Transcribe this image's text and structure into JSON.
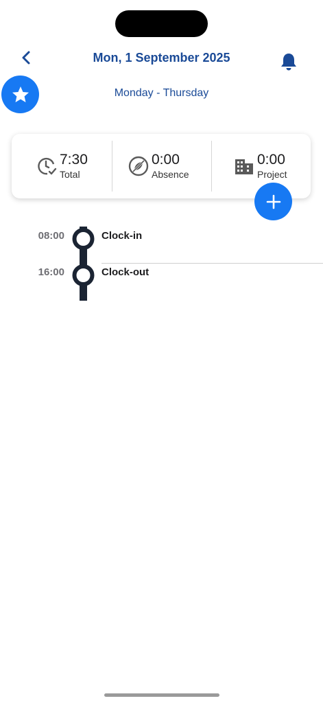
{
  "header": {
    "title": "Mon, 1 September 2025",
    "subtitle": "Monday - Thursday"
  },
  "summary": [
    {
      "icon": "clock-check-icon",
      "value": "7:30",
      "label": "Total"
    },
    {
      "icon": "absence-icon",
      "value": "0:00",
      "label": "Absence"
    },
    {
      "icon": "building-icon",
      "value": "0:00",
      "label": "Project"
    }
  ],
  "timeline": [
    {
      "time": "08:00",
      "label": "Clock-in"
    },
    {
      "time": "16:00",
      "label": "Clock-out"
    }
  ],
  "colors": {
    "accent": "#1779f3",
    "title": "#1a4a97",
    "timeline": "#1b2433"
  }
}
